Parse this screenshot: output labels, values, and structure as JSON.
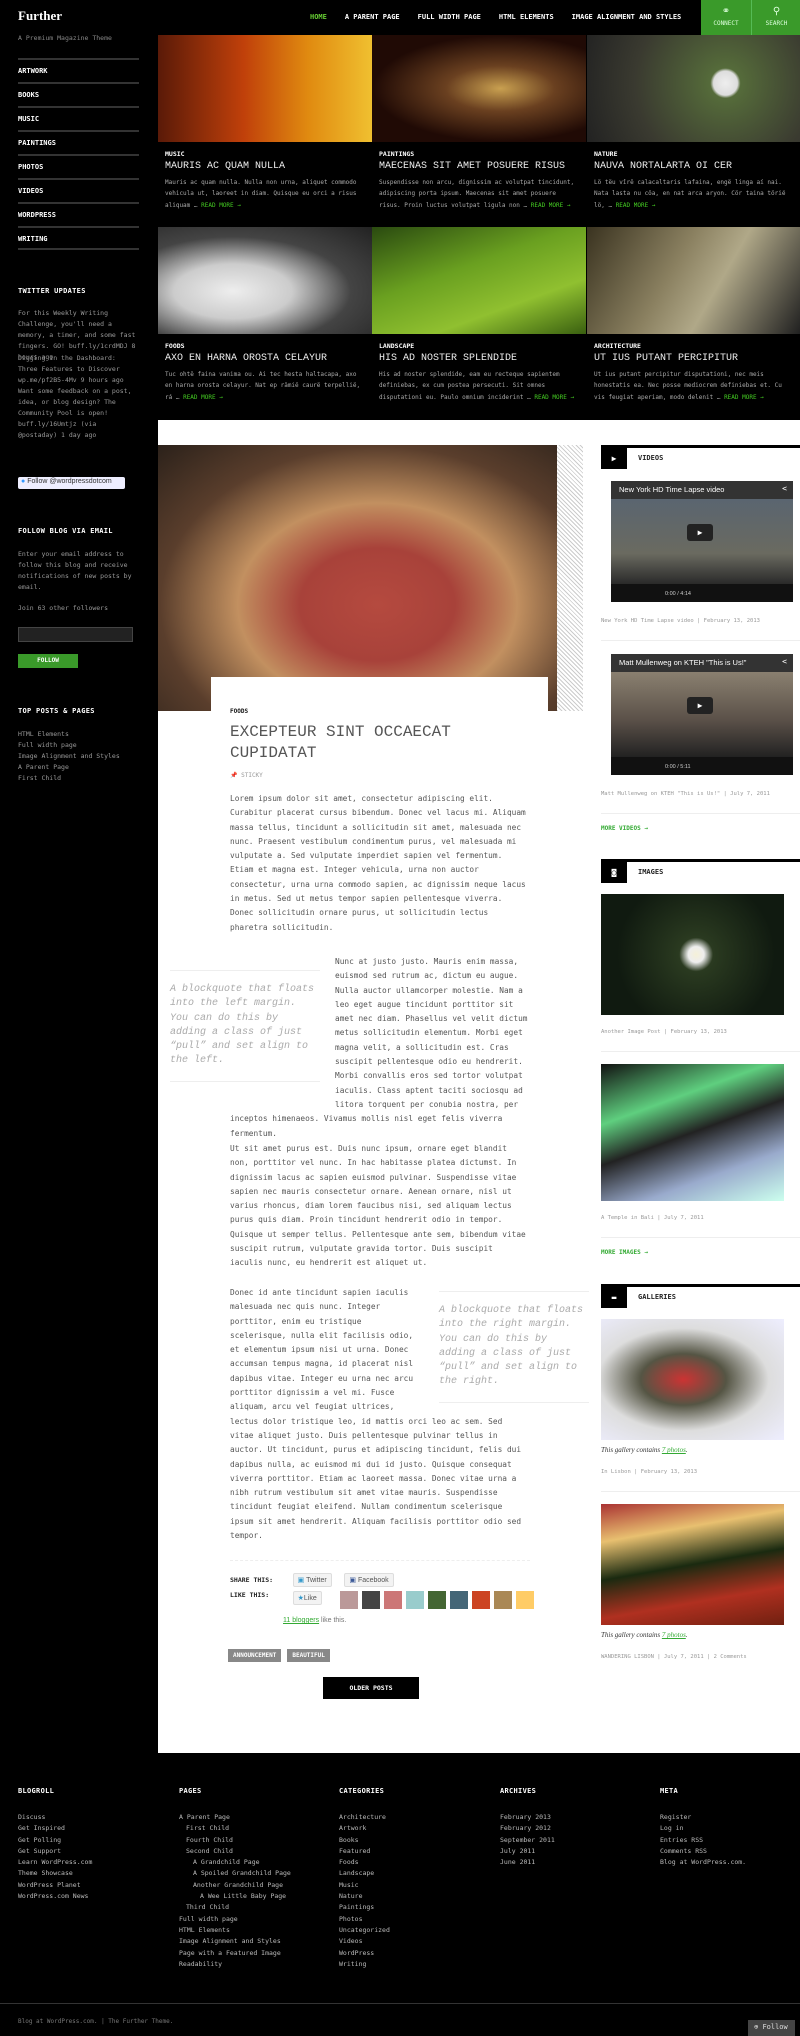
{
  "site": {
    "title": "Further",
    "tagline": "A Premium Magazine Theme"
  },
  "menu": [
    "ARTWORK",
    "BOOKS",
    "MUSIC",
    "PAINTINGS",
    "PHOTOS",
    "VIDEOS",
    "WORDPRESS",
    "WRITING"
  ],
  "topnav": {
    "items": [
      "HOME",
      "A PARENT PAGE",
      "FULL WIDTH PAGE",
      "HTML ELEMENTS",
      "IMAGE ALIGNMENT AND STYLES"
    ],
    "connect": "CONNECT",
    "search": "SEARCH",
    "accent": "#3a9a2a"
  },
  "twitter": {
    "title": "TWITTER UPDATES",
    "tweets": [
      "For this Weekly Writing Challenge, you'll need a memory, a timer, and some fast fingers. GO! buff.ly/1crdMDJ 8 hours ago",
      "Digging In the Dashboard: Three Features to Discover wp.me/pf2B5-4Mv 9 hours ago",
      "Want some feedback on a post, idea, or blog design? The Community Pool is open! buff.ly/16Umtjz (via @postaday) 1 day ago"
    ],
    "follow_button": "Follow @wordpressdotcom"
  },
  "email": {
    "title": "FOLLOW BLOG VIA EMAIL",
    "text": "Enter your email address to follow this blog and receive notifications of new posts by email.",
    "followers": "Join 63 other followers",
    "input_value": "",
    "button": "FOLLOW"
  },
  "top_posts": {
    "title": "TOP POSTS & PAGES",
    "items": [
      "HTML Elements",
      "Full width page",
      "Image Alignment and Styles",
      "A Parent Page",
      "First Child"
    ]
  },
  "featured": [
    {
      "cat": "MUSIC",
      "title": "MAURIS AC QUAM NULLA",
      "excerpt": "Mauris ac quam nulla. Nulla non urna, aliquet commodo vehicula ut, laoreet in diam. Quisque eu orci a risus aliquam …",
      "more": "READ MORE →"
    },
    {
      "cat": "PAINTINGS",
      "title": "MAECENAS SIT AMET POSUERE RISUS",
      "excerpt": "Suspendisse non arcu, dignissim ac volutpat tincidunt, adipiscing porta ipsum. Maecenas sit amet posuere risus. Proin luctus volutpat ligula non …",
      "more": "READ MORE →"
    },
    {
      "cat": "NATURE",
      "title": "NAUVA NORTALARTA OI CER",
      "excerpt": "Lö tëu vîrë calacaltaris lafaina, engë linga aí nai. Nata lasta nu cöa, en nat arca aryon. Cör taina töriё lö, …",
      "more": "READ MORE →"
    },
    {
      "cat": "FOODS",
      "title": "AXO EN HARNA OROSTA CELAYUR",
      "excerpt": "Tuc ohtë faina vanima ou. Ai tec hesta haltacapa, axo en harna orosta celayur. Nat ep rämië caurë terpellië, rá …",
      "more": "READ MORE →"
    },
    {
      "cat": "LANDSCAPE",
      "title": "HIS AD NOSTER SPLENDIDE",
      "excerpt": "His ad noster splendide, eam eu recteque sapientem definiebas, ex cum postea persecuti. Sit omnes disputationi eu. Paulo omnium inciderint …",
      "more": "READ MORE →"
    },
    {
      "cat": "ARCHITECTURE",
      "title": "UT IUS PUTANT PERCIPITUR",
      "excerpt": "Ut ius putant percipitur disputationi, nec meis honestatis ea. Nec posse mediocrem definiebas et. Cu vis feugiat aperiam, modo delenit …",
      "more": "READ MORE →"
    }
  ],
  "post": {
    "category": "FOODS",
    "title": "EXCEPTEUR SINT OCCAECAT CUPIDATAT",
    "sticky": "STICKY",
    "p1": "Lorem ipsum dolor sit amet, consectetur adipiscing elit. Curabitur placerat cursus bibendum. Donec vel lacus mi. Aliquam massa tellus, tincidunt a sollicitudin sit amet, malesuada nec nunc. Praesent vestibulum condimentum purus, vel malesuada mi vulputate a. Sed vulputate imperdiet sapien vel fermentum. Etiam et magna est. Integer vehicula, urna non auctor consectetur, urna urna commodo sapien, ac dignissim neque lacus in metus. Sed ut metus tempor sapien pellentesque viverra. Donec sollicitudin ornare purus, ut sollicitudin lectus pharetra sollicitudin.",
    "pull_left": "A blockquote that floats into the left margin. You can do this by adding a class of just “pull” and set align to the left.",
    "p2": "Nunc at justo justo. Mauris enim massa, euismod sed rutrum ac, dictum eu augue. Nulla auctor ullamcorper molestie. Nam a leo eget augue tincidunt porttitor sit amet nec diam. Phasellus vel velit dictum metus sollicitudin elementum. Morbi eget magna velit, a sollicitudin est. Cras suscipit pellentesque odio eu hendrerit. Morbi convallis eros sed tortor volutpat iaculis. Class aptent taciti sociosqu ad litora torquent per conubia nostra, per inceptos himenaeos. Vivamus mollis nisl eget felis viverra fermentum.",
    "p3": "Ut sit amet purus est. Duis nunc ipsum, ornare eget blandit non, porttitor vel nunc. In hac habitasse platea dictumst. In dignissim lacus ac sapien euismod pulvinar. Suspendisse vitae sapien nec mauris consectetur ornare. Aenean ornare, nisl ut varius rhoncus, diam lorem faucibus nisi, sed aliquam lectus purus quis diam. Proin tincidunt hendrerit odio in tempor. Quisque ut semper tellus. Pellentesque ante sem, bibendum vitae suscipit rutrum, vulputate gravida tortor. Duis suscipit iaculis nunc, eu hendrerit est aliquet ut.",
    "pull_right": "A blockquote that floats into the right margin. You can do this by adding a class of just “pull” and set align to the right.",
    "p4": "Donec id ante tincidunt sapien iaculis malesuada nec quis nunc. Integer porttitor, enim eu tristique scelerisque, nulla elit facilisis odio, et elementum ipsum nisi ut urna. Donec accumsan tempus magna, id placerat nisl dapibus vitae. Integer eu urna nec arcu porttitor dignissim a vel mi. Fusce aliquam, arcu vel feugiat ultrices, lectus dolor tristique leo, id mattis orci leo ac sem. Sed vitae aliquet justo. Duis pellentesque pulvinar tellus in auctor. Ut tincidunt, purus et adipiscing tincidunt, felis dui dapibus nulla, ac euismod mi dui id justo. Quisque consequat viverra porttitor. Etiam ac laoreet massa. Donec vitae urna a nibh rutrum vestibulum sit amet vitae mauris. Suspendisse tincidunt feugiat eleifend. Nullam condimentum scelerisque ipsum sit amet hendrerit. Aliquam facilisis porttitor odio sed tempor.",
    "share_label": "SHARE THIS:",
    "twitter": "Twitter",
    "facebook": "Facebook",
    "like_label": "LIKE THIS:",
    "like": "Like",
    "bloggers": "11 bloggers",
    "like_suffix": " like this.",
    "tags": [
      "ANNOUNCEMENT",
      "BEAUTIFUL"
    ],
    "older": "OLDER POSTS"
  },
  "widgets": {
    "videos": {
      "title": "VIDEOS",
      "items": [
        {
          "video_title": "New York HD Time Lapse video",
          "time": "0:00 / 4:14",
          "meta": "New York HD Time Lapse video | February 13, 2013"
        },
        {
          "video_title": "Matt Mullenweg on KTEH \"This is Us!\"",
          "time": "0:00 / 5:11",
          "meta": "Matt Mullenweg on KTEH \"This is Us!\" | July 7, 2011"
        }
      ],
      "more": "MORE VIDEOS →"
    },
    "images": {
      "title": "IMAGES",
      "items": [
        {
          "meta": "Another Image Post | February 13, 2013"
        },
        {
          "meta": "A Temple in Bali | July 7, 2011"
        }
      ],
      "more": "MORE IMAGES →"
    },
    "galleries": {
      "title": "GALLERIES",
      "caption": "This gallery contains ",
      "link": "7 photos",
      "items": [
        {
          "meta": "In Lisbon | February 13, 2013"
        },
        {
          "meta": "WANDERING LISBON | July 7, 2011 | 2 Comments"
        }
      ]
    }
  },
  "footer": {
    "blogroll": {
      "title": "BLOGROLL",
      "items": [
        "Discuss",
        "Get Inspired",
        "Get Polling",
        "Get Support",
        "Learn WordPress.com",
        "Theme Showcase",
        "WordPress Planet",
        "WordPress.com News"
      ]
    },
    "pages": {
      "title": "PAGES",
      "items": [
        "A Parent Page",
        "First Child",
        "Fourth Child",
        "Second Child",
        "A Grandchild Page",
        "A Spoiled Grandchild Page",
        "Another Grandchild Page",
        "A Wee Little Baby Page",
        "Third Child",
        "Full width page",
        "HTML Elements",
        "Image Alignment and Styles",
        "Page with a Featured Image",
        "Readability"
      ]
    },
    "categories": {
      "title": "CATEGORIES",
      "items": [
        "Architecture",
        "Artwork",
        "Books",
        "Featured",
        "Foods",
        "Landscape",
        "Music",
        "Nature",
        "Paintings",
        "Photos",
        "Uncategorized",
        "Videos",
        "WordPress",
        "Writing"
      ]
    },
    "archives": {
      "title": "ARCHIVES",
      "items": [
        "February 2013",
        "February 2012",
        "September 2011",
        "July 2011",
        "June 2011"
      ]
    },
    "meta": {
      "title": "META",
      "items": [
        "Register",
        "Log in",
        "Entries RSS",
        "Comments RSS",
        "Blog at WordPress.com."
      ]
    },
    "credit": "Blog at WordPress.com. | The Further Theme.",
    "follow": "Follow"
  }
}
